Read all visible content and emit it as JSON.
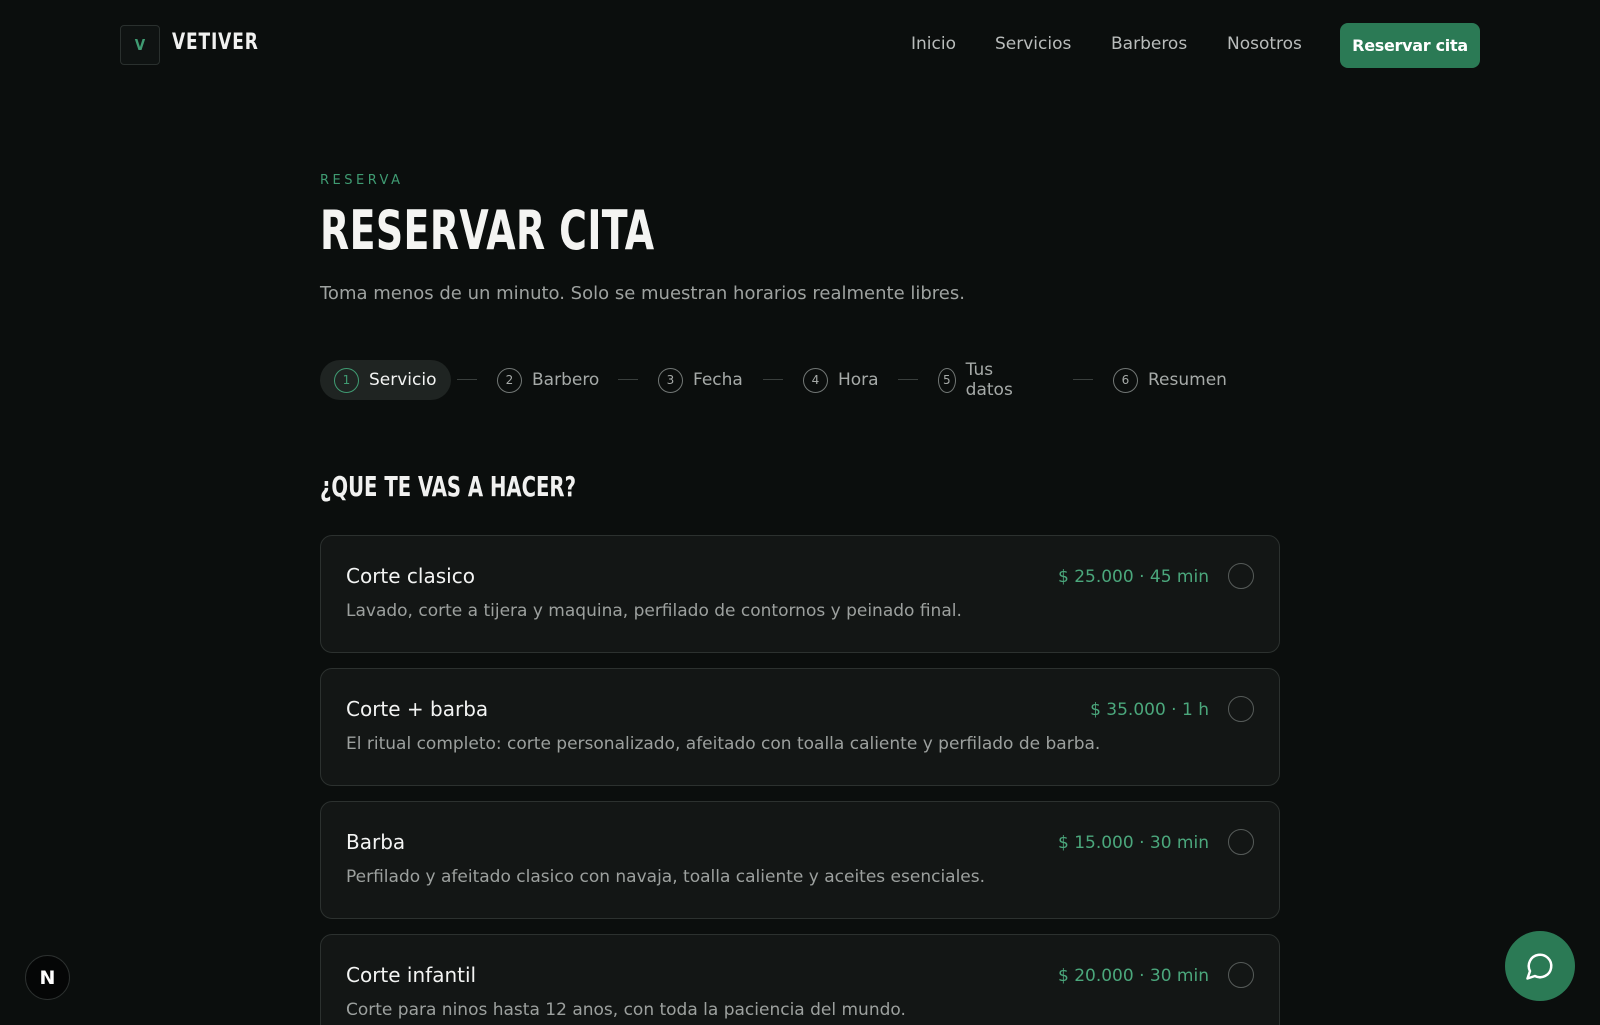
{
  "brand": {
    "logo_letter": "V",
    "name": "VETIVER"
  },
  "nav": {
    "items": [
      "Inicio",
      "Servicios",
      "Barberos",
      "Nosotros"
    ],
    "cta_label": "Reservar cita"
  },
  "hero": {
    "eyebrow": "RESERVA",
    "title": "RESERVAR CITA",
    "subtitle": "Toma menos de un minuto. Solo se muestran horarios realmente libres."
  },
  "steps": [
    {
      "num": "1",
      "label": "Servicio",
      "active": true
    },
    {
      "num": "2",
      "label": "Barbero",
      "active": false
    },
    {
      "num": "3",
      "label": "Fecha",
      "active": false
    },
    {
      "num": "4",
      "label": "Hora",
      "active": false
    },
    {
      "num": "5",
      "label": "Tus datos",
      "active": false
    },
    {
      "num": "6",
      "label": "Resumen",
      "active": false
    }
  ],
  "section": {
    "title": "¿QUE TE VAS A HACER?"
  },
  "services": [
    {
      "name": "Corte clasico",
      "meta": "$ 25.000 · 45 min",
      "description": "Lavado, corte a tijera y maquina, perfilado de contornos y peinado final."
    },
    {
      "name": "Corte + barba",
      "meta": "$ 35.000 · 1 h",
      "description": "El ritual completo: corte personalizado, afeitado con toalla caliente y perfilado de barba."
    },
    {
      "name": "Barba",
      "meta": "$ 15.000 · 30 min",
      "description": "Perfilado y afeitado clasico con navaja, toalla caliente y aceites esenciales."
    },
    {
      "name": "Corte infantil",
      "meta": "$ 20.000 · 30 min",
      "description": "Corte para ninos hasta 12 anos, con toda la paciencia del mundo."
    }
  ],
  "floating": {
    "dev_badge": "N"
  },
  "colors": {
    "accent": "#2b7a55",
    "accent_text": "#4ba77c",
    "background": "#0b0e0d"
  }
}
